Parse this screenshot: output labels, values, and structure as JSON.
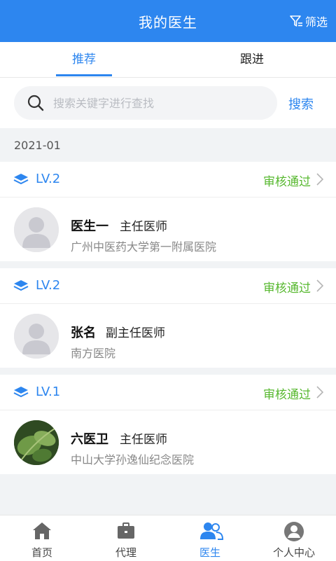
{
  "header": {
    "title": "我的医生",
    "filter_label": "筛选",
    "filter_icon": "filter-icon"
  },
  "tabs": [
    {
      "label": "推荐",
      "active": true
    },
    {
      "label": "跟进",
      "active": false
    }
  ],
  "search": {
    "placeholder": "搜索关键字进行查找",
    "value": "",
    "button_label": "搜索",
    "icon": "search-icon"
  },
  "group": {
    "month": "2021-01"
  },
  "doctors": [
    {
      "level": "LV.2",
      "status": "审核通过",
      "name": "医生一",
      "title": "主任医师",
      "hospital": "广州中医药大学第一附属医院",
      "avatar": "default-avatar"
    },
    {
      "level": "LV.2",
      "status": "审核通过",
      "name": "张名",
      "title": "副主任医师",
      "hospital": "南方医院",
      "avatar": "default-avatar"
    },
    {
      "level": "LV.1",
      "status": "审核通过",
      "name": "六医卫",
      "title": "主任医师",
      "hospital": "中山大学孙逸仙纪念医院",
      "avatar": "plant-photo-avatar"
    }
  ],
  "bottom_nav": [
    {
      "label": "首页",
      "icon": "home-icon",
      "active": false
    },
    {
      "label": "代理",
      "icon": "briefcase-icon",
      "active": false
    },
    {
      "label": "医生",
      "icon": "doctors-icon",
      "active": true
    },
    {
      "label": "个人中心",
      "icon": "user-icon",
      "active": false
    }
  ],
  "colors": {
    "primary": "#2d86ef",
    "status_green": "#57b82f",
    "background": "#f1f3f5"
  }
}
